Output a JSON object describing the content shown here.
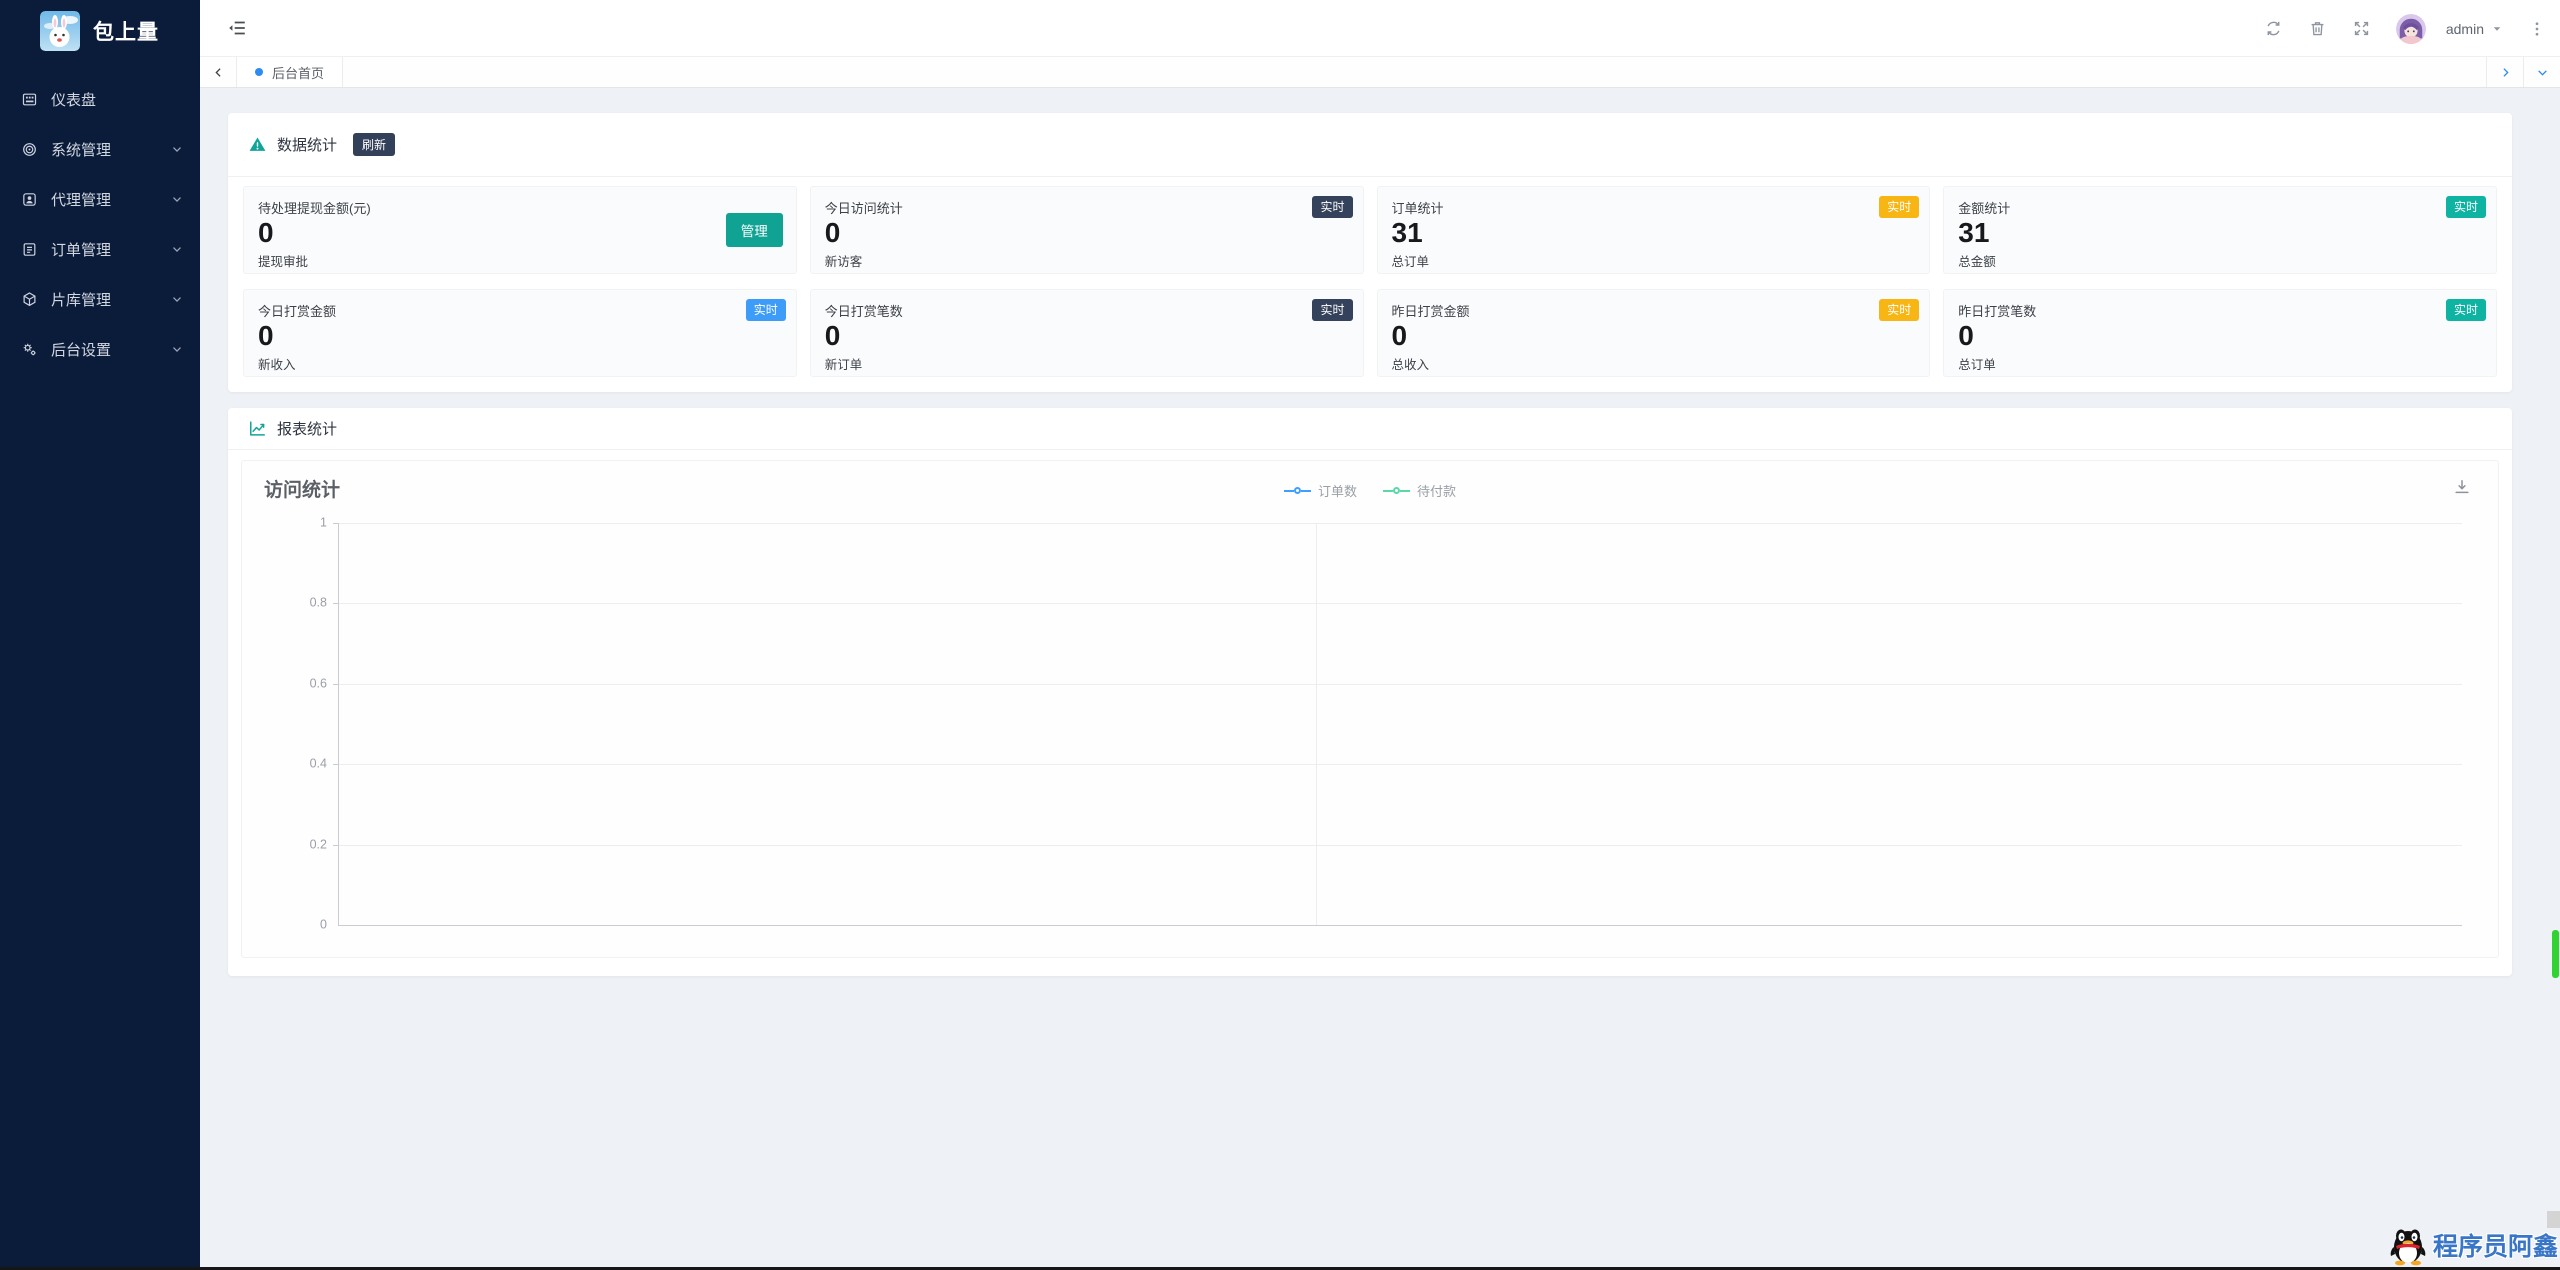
{
  "app": {
    "logo_title": "包上量"
  },
  "sidebar": {
    "items": [
      {
        "label": "仪表盘",
        "icon": "dashboard-icon",
        "has_submenu": false
      },
      {
        "label": "系统管理",
        "icon": "system-icon",
        "has_submenu": true
      },
      {
        "label": "代理管理",
        "icon": "agent-icon",
        "has_submenu": true
      },
      {
        "label": "订单管理",
        "icon": "order-icon",
        "has_submenu": true
      },
      {
        "label": "片库管理",
        "icon": "library-icon",
        "has_submenu": true
      },
      {
        "label": "后台设置",
        "icon": "settings-icon",
        "has_submenu": true
      }
    ]
  },
  "topbar": {
    "username": "admin",
    "icons": [
      "menu-fold-icon",
      "refresh-icon",
      "trash-icon",
      "fullscreen-icon",
      "more-vertical-icon"
    ]
  },
  "tabbar": {
    "active_tab": "后台首页"
  },
  "stats": {
    "title": "数据统计",
    "refresh_badge": "刷新",
    "cards": [
      {
        "title": "待处理提现金额(元)",
        "value": "0",
        "subtitle": "提现审批",
        "action_label": "管理"
      },
      {
        "title": "今日访问统计",
        "value": "0",
        "subtitle": "新访客",
        "badge": "实时",
        "badge_color": "#35425b"
      },
      {
        "title": "订单统计",
        "value": "31",
        "subtitle": "总订单",
        "badge": "实时",
        "badge_color": "#f8b615"
      },
      {
        "title": "金额统计",
        "value": "31",
        "subtitle": "总金额",
        "badge": "实时",
        "badge_color": "#0fb3a2"
      },
      {
        "title": "今日打赏金额",
        "value": "0",
        "subtitle": "新收入",
        "badge": "实时",
        "badge_color": "#3d9cf7"
      },
      {
        "title": "今日打赏笔数",
        "value": "0",
        "subtitle": "新订单",
        "badge": "实时",
        "badge_color": "#35425b"
      },
      {
        "title": "昨日打赏金额",
        "value": "0",
        "subtitle": "总收入",
        "badge": "实时",
        "badge_color": "#f8b615"
      },
      {
        "title": "昨日打赏笔数",
        "value": "0",
        "subtitle": "总订单",
        "badge": "实时",
        "badge_color": "#0fb3a2"
      }
    ]
  },
  "report": {
    "title": "报表统计"
  },
  "chart_data": {
    "type": "line",
    "title": "访问统计",
    "series": [
      {
        "name": "订单数",
        "color": "#409eff",
        "values": []
      },
      {
        "name": "待付款",
        "color": "#5ad8a6",
        "values": []
      }
    ],
    "x": [],
    "ylim": [
      0,
      1
    ],
    "ytick_labels": [
      "1",
      "0.8",
      "0.6",
      "0.4",
      "0.2",
      "0"
    ],
    "grid": true,
    "legend_position": "top-center",
    "has_download_button": true
  },
  "footer": {
    "qq_badge_text": "程序员阿鑫"
  },
  "colors": {
    "sidebar_bg": "#0b1b3a",
    "accent_teal": "#10a394",
    "accent_blue": "#2d8cf0",
    "badge_dark": "#35425b",
    "badge_yellow": "#f8b615",
    "badge_teal": "#0fb3a2",
    "badge_blue": "#3d9cf7",
    "legend_blue": "#409eff",
    "legend_green": "#5ad8a6",
    "scroll_thumb_green": "#30d331"
  }
}
